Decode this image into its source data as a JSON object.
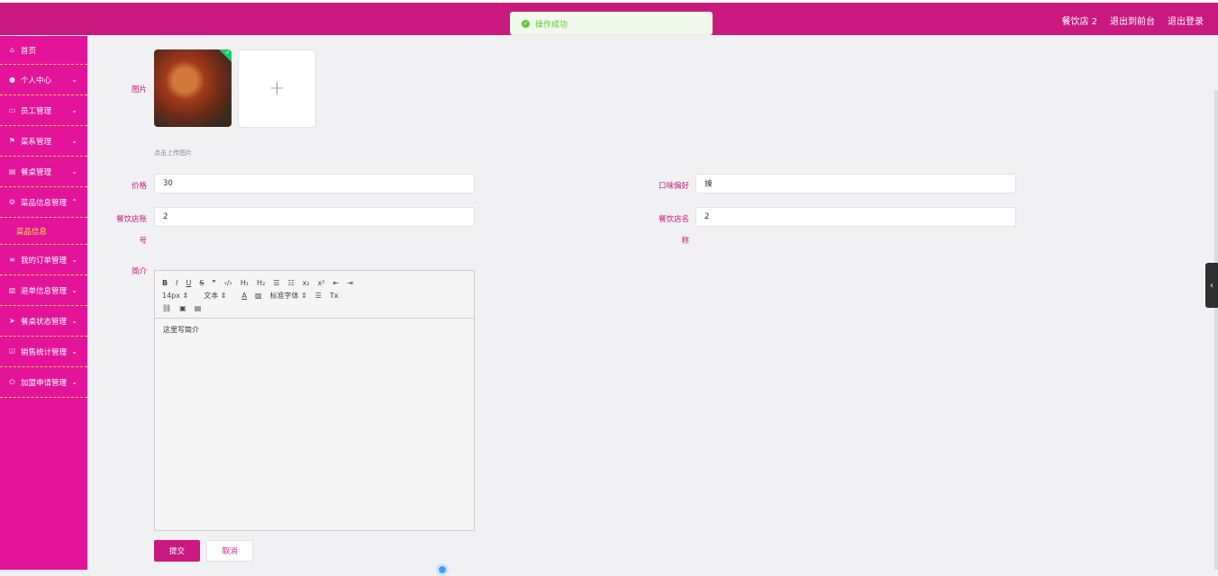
{
  "header": {
    "user": "餐饮店 2",
    "back_to_front": "退出到前台",
    "logout": "退出登录"
  },
  "toast": {
    "message": "操作成功"
  },
  "sidebar": {
    "items": [
      {
        "label": "首页",
        "icon": "home-icon"
      },
      {
        "label": "个人中心",
        "icon": "user-icon"
      },
      {
        "label": "员工管理",
        "icon": "chat-icon"
      },
      {
        "label": "菜系管理",
        "icon": "flag-icon"
      },
      {
        "label": "餐桌管理",
        "icon": "clipboard-icon"
      },
      {
        "label": "菜品信息管理",
        "icon": "gear-icon"
      },
      {
        "label": "我的订单管理",
        "icon": "list-icon"
      },
      {
        "label": "退单信息管理",
        "icon": "chart-icon"
      },
      {
        "label": "餐桌状态管理",
        "icon": "send-icon"
      },
      {
        "label": "销售统计管理",
        "icon": "check-icon"
      },
      {
        "label": "加盟申请管理",
        "icon": "power-icon"
      }
    ],
    "sub_item": "菜品信息"
  },
  "form": {
    "image_label": "图片",
    "upload_hint": "点击上传图片",
    "price_label": "价格",
    "price_value": "30",
    "taste_label": "口味偏好",
    "taste_value": "辣",
    "account_label_1": "餐饮店账",
    "account_label_2": "号",
    "account_value": "2",
    "name_label_1": "餐饮店名",
    "name_label_2": "称",
    "name_value": "2",
    "intro_label": "简介",
    "editor": {
      "font_size": "14px",
      "text_style": "文本",
      "font_family": "标准字体",
      "content": "这里写简介"
    },
    "submit": "提交",
    "cancel": "取消"
  }
}
